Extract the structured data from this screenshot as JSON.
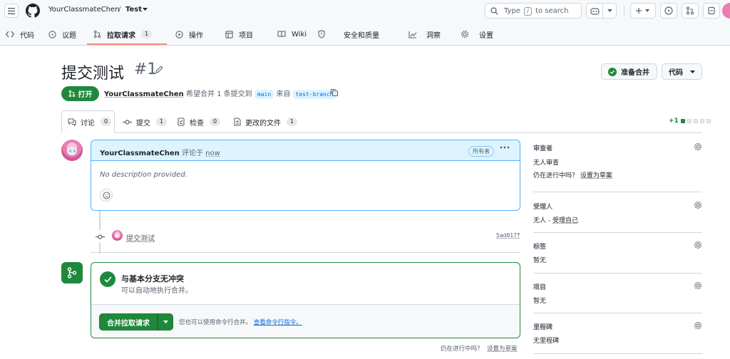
{
  "header": {
    "owner": "YourClassmateChen",
    "separator": "/",
    "repo": "Test",
    "search_placeholder_pre": "Type",
    "search_key": "/",
    "search_placeholder_post": "to search"
  },
  "repo_nav": [
    {
      "label": "代码",
      "icon": "code-icon"
    },
    {
      "label": "议题",
      "icon": "issue-icon"
    },
    {
      "label": "拉取请求",
      "icon": "pull-request-icon",
      "count": "1",
      "active": true
    },
    {
      "label": "操作",
      "icon": "play-icon"
    },
    {
      "label": "项目",
      "icon": "table-icon"
    },
    {
      "label": "Wiki",
      "icon": "book-icon"
    },
    {
      "label": "安全和质量",
      "icon": "shield-icon"
    },
    {
      "label": "洞察",
      "icon": "graph-icon"
    },
    {
      "label": "设置",
      "icon": "gear-icon"
    }
  ],
  "pr": {
    "title": "提交测试",
    "number": "#1",
    "state": "打开",
    "author": "YourClassmateChen",
    "meta_mid": "希望合并 1 条提交到",
    "base": "main",
    "meta_from": "来自",
    "head": "test-branch",
    "ready_label": "准备合并",
    "code_label": "代码"
  },
  "pr_tabs": [
    {
      "label": "讨论",
      "count": "0"
    },
    {
      "label": "提交",
      "count": "1"
    },
    {
      "label": "检查",
      "count": "0"
    },
    {
      "label": "更改的文件",
      "count": "1"
    }
  ],
  "diffstat": {
    "additions": "+1"
  },
  "comment": {
    "author": "YourClassmateChen",
    "action": "评论于",
    "time": "now",
    "badge": "所有者",
    "body": "No description provided."
  },
  "commit": {
    "message": "提交测试",
    "sha": "5ad017f"
  },
  "merge": {
    "title": "与基本分支无冲突",
    "subtitle": "可以自动地执行合并。",
    "button": "合并拉取请求",
    "hint": "您也可以使用命令行合并。",
    "hint_link": "查看命令行指令。",
    "wip_q": "仍在进行中吗？",
    "wip_link": "设置为草案"
  },
  "sidebar": {
    "reviewers": {
      "title": "审查者",
      "value": "无人审查",
      "wip_q": "仍在进行中吗？",
      "wip_link": "设置为草案"
    },
    "assignees": {
      "title": "受理人",
      "value": "无人 - ",
      "link": "受理自己"
    },
    "labels": {
      "title": "标签",
      "value": "暂无"
    },
    "projects": {
      "title": "项目",
      "value": "暂无"
    },
    "milestone": {
      "title": "里程碑",
      "value": "无里程碑"
    }
  },
  "colors": {
    "accent_green": "#1f883d",
    "link_blue": "#0969da",
    "tab_underline": "#fd8c73"
  }
}
